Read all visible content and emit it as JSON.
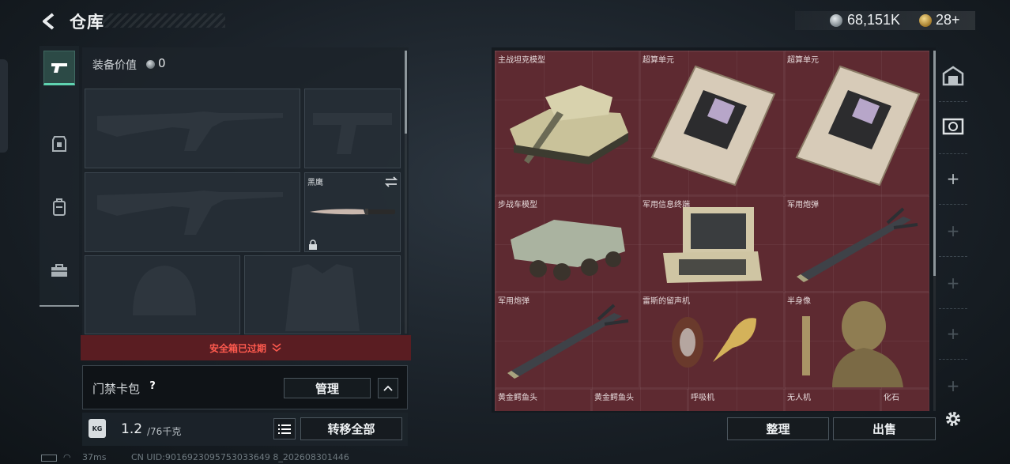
{
  "header": {
    "title": "仓库",
    "silver_amount": "68,151K",
    "gold_amount": "28+"
  },
  "nav": {
    "items": [
      "pistol-icon",
      "armor-icon",
      "backpack-icon",
      "case-icon"
    ]
  },
  "equipment": {
    "value_label": "装备价值",
    "value": "0",
    "knife_name": "黑鹰"
  },
  "safe_box": {
    "status": "安全箱已过期"
  },
  "card_pack": {
    "label": "门禁卡包",
    "help": "?",
    "manage_button": "管理"
  },
  "capacity": {
    "used": "1.2",
    "total": "/76千克",
    "lock_label": "KG",
    "transfer_all": "转移全部"
  },
  "warehouse": {
    "items": [
      {
        "name": "主战坦克模型"
      },
      {
        "name": "超算单元"
      },
      {
        "name": "超算单元"
      },
      {
        "name": "步战车模型"
      },
      {
        "name": "军用信息终端"
      },
      {
        "name": "军用炮弹"
      },
      {
        "name": "军用炮弹"
      },
      {
        "name": "雷斯的留声机"
      },
      {
        "name": "半身像"
      }
    ],
    "partial_row": [
      "黄金鳄鱼头",
      "黄金鳄鱼头",
      "呼吸机",
      "无人机",
      "化石"
    ],
    "sort_button": "整理",
    "sell_button": "出售"
  },
  "status_bar": {
    "ping": "37ms",
    "uid": "CN UID:9016923095753033649 8_202608301446"
  }
}
